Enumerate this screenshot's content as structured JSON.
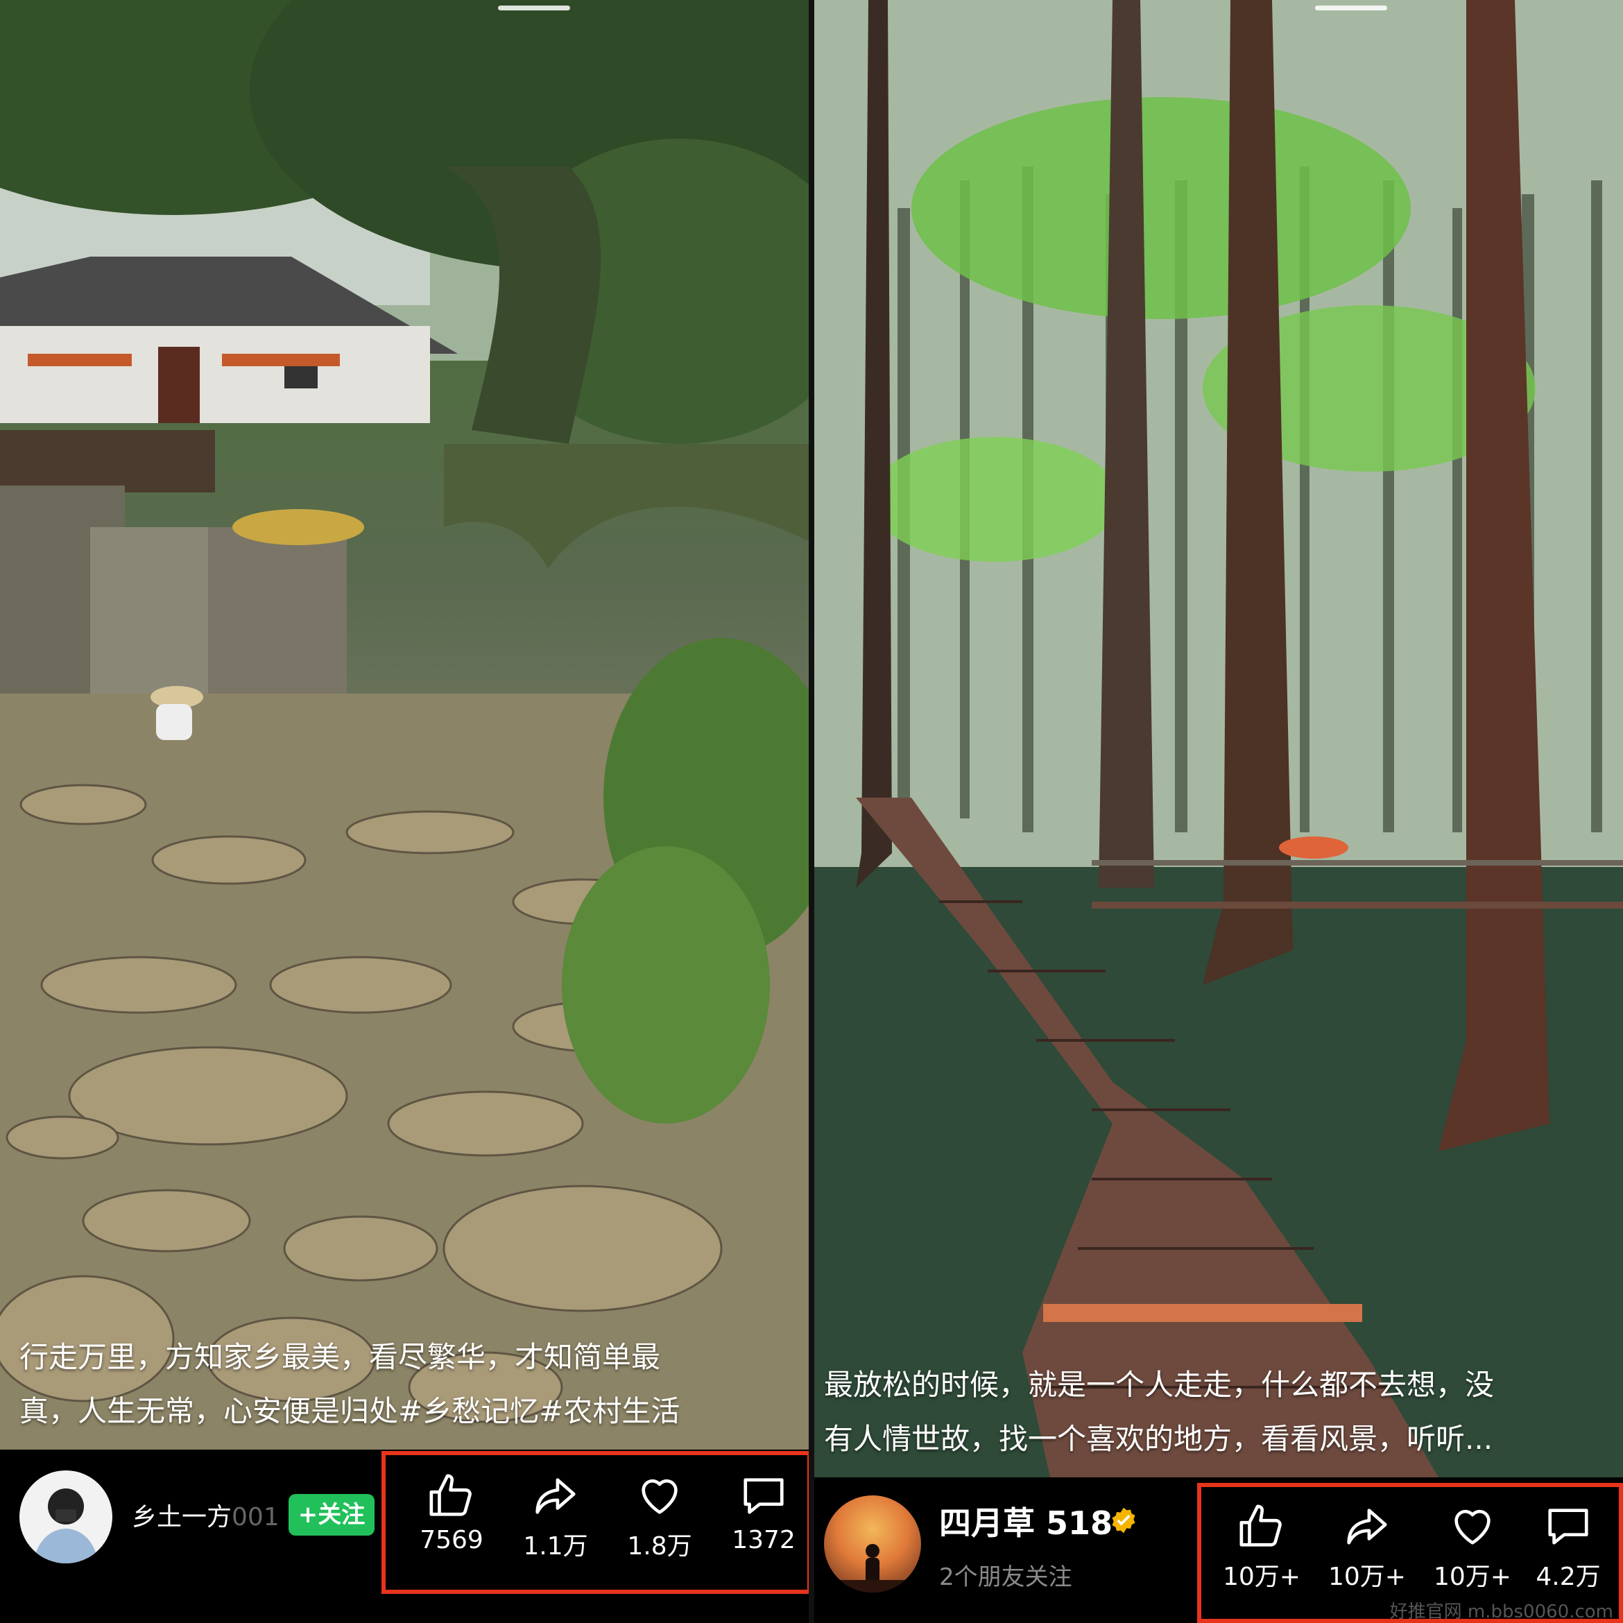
{
  "left_post": {
    "caption_line1": "行走万里，方知家乡最美，看尽繁华，才知简单最",
    "caption_line2": "真，人生无常，心安便是归处#乡愁记忆#农村生活",
    "author": "乡土一方",
    "author_suffix": "001",
    "follow_label": "+关注",
    "actions": [
      {
        "name": "like",
        "icon": "thumbs-up-icon",
        "count": "7569"
      },
      {
        "name": "share",
        "icon": "share-arrow-icon",
        "count": "1.1万"
      },
      {
        "name": "favorite",
        "icon": "heart-icon",
        "count": "1.8万"
      },
      {
        "name": "comment",
        "icon": "comment-icon",
        "count": "1372"
      }
    ]
  },
  "right_post": {
    "caption_line1": "最放松的时候，就是一个人走走，什么都不去想，没",
    "caption_line2": "有人情世故，找一个喜欢的地方，看看风景，听听...",
    "author": "四月草 518",
    "verified": true,
    "friends_following": "2个朋友关注",
    "actions": [
      {
        "name": "like",
        "icon": "thumbs-up-icon",
        "count": "10万+"
      },
      {
        "name": "share",
        "icon": "share-arrow-icon",
        "count": "10万+"
      },
      {
        "name": "favorite",
        "icon": "heart-icon",
        "count": "10万+"
      },
      {
        "name": "comment",
        "icon": "comment-icon",
        "count": "4.2万"
      }
    ]
  },
  "watermark": "好推官网 m.bbs0060.com",
  "colors": {
    "highlight": "#e8341c",
    "follow": "#21c05a",
    "verified": "#f5b400"
  }
}
